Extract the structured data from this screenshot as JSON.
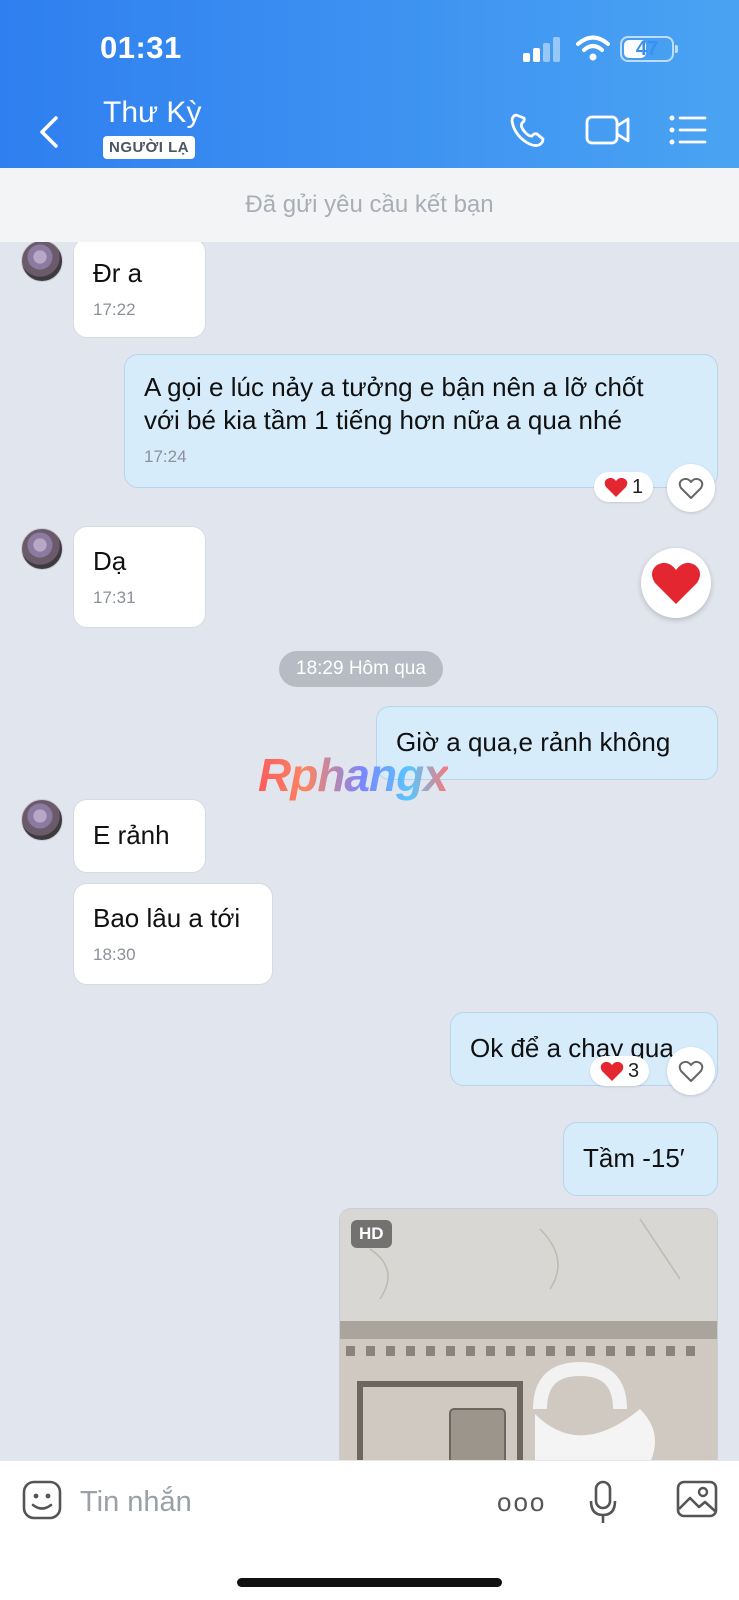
{
  "status": {
    "time": "01:31",
    "battery": "47"
  },
  "header": {
    "contact_name": "Thư Kỳ",
    "badge": "NGƯỜI LẠ",
    "icons": [
      "back-icon",
      "phone-icon",
      "video-call-icon",
      "menu-list-icon"
    ]
  },
  "banner": {
    "text": "Đã gửi yêu cầu kết bạn"
  },
  "messages": [
    {
      "side": "in",
      "text": "Đr a",
      "time": "17:22"
    },
    {
      "side": "out",
      "text_line1": "A gọi e lúc nảy a tưởng e bận nên a lỡ chốt",
      "text_line2": "với bé kia tầm 1 tiếng hơn nữa a qua nhé",
      "time": "17:24",
      "reaction_count": "1"
    },
    {
      "side": "in",
      "text": "Dạ",
      "time": "17:31"
    },
    {
      "type": "date_chip",
      "text": "18:29 Hôm qua"
    },
    {
      "side": "out",
      "text": "Giờ a qua,e rảnh không"
    },
    {
      "side": "in",
      "text": "E rảnh"
    },
    {
      "side": "in",
      "text": "Bao lâu a tới",
      "time": "18:30"
    },
    {
      "side": "out",
      "text": "Ok để a chạy qua",
      "reaction_count": "3"
    },
    {
      "side": "out",
      "text": "Tầm -15′"
    },
    {
      "side": "out",
      "type": "image",
      "badge": "HD"
    }
  ],
  "watermark": "Rphangx",
  "composer": {
    "placeholder": "Tin nhắn",
    "more_label": "ooo"
  },
  "colors": {
    "header_start": "#2f7ff0",
    "header_end": "#4aa3f2",
    "bubble_out": "#d7ecfb",
    "heart": "#e3262f"
  }
}
